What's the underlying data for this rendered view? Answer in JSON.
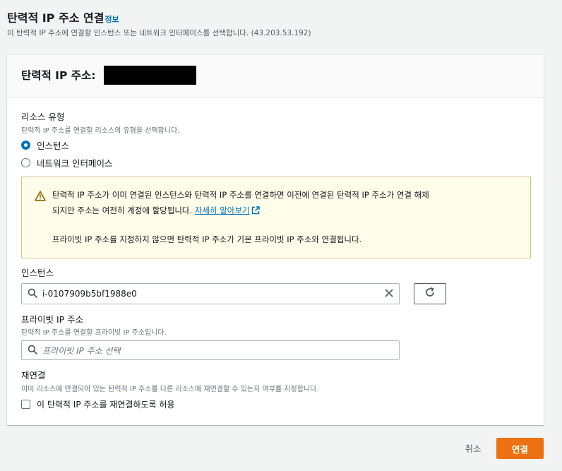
{
  "header": {
    "title": "탄력적 IP 주소 연결",
    "info_link": "정보",
    "description": "이 탄력적 IP 주소에 연결할 인스턴스 또는 네트워크 인터페이스를 선택합니다. (43.203.53.192)"
  },
  "panel": {
    "title": "탄력적 IP 주소:"
  },
  "resource_type": {
    "label": "리소스 유형",
    "description": "탄력적 IP 주소를 연결할 리소스의 유형을 선택합니다.",
    "options": [
      {
        "label": "인스턴스",
        "selected": true
      },
      {
        "label": "네트워크 인터페이스",
        "selected": false
      }
    ]
  },
  "alert": {
    "line1": "탄력적 IP 주소가 이미 연결된 인스턴스와 탄력적 IP 주소를 연결하면 이전에 연결된 탄력적 IP 주소가 연결 해제",
    "line2_prefix": "되지만 주소는 여전히 계정에 할당됩니다. ",
    "link": "자세히 알아보기",
    "line3": "프라이빗 IP 주소를 지정하지 않으면 탄력적 IP 주소가 기본 프라이빗 IP 주소와 연결됩니다."
  },
  "instance": {
    "label": "인스턴스",
    "value": "i-0107909b5bf1988e0"
  },
  "private_ip": {
    "label": "프라이빗 IP 주소",
    "description": "탄력적 IP 주소를 연결할 프라이빗 IP 주소입니다.",
    "placeholder": "프라이빗 IP 주소 선택"
  },
  "reassociation": {
    "label": "재연결",
    "description": "이미 리소스에 연결되어 있는 탄력적 IP 주소를 다른 리소스에 재연결할 수 있는지 여부를 지정합니다.",
    "checkbox_label": "이 탄력적 IP 주소를 재연결하도록 허용",
    "checked": false
  },
  "footer": {
    "cancel": "취소",
    "submit": "연결"
  },
  "colors": {
    "primary": "#ec7211",
    "link": "#0073bb",
    "alert_bg": "#fffce9"
  }
}
